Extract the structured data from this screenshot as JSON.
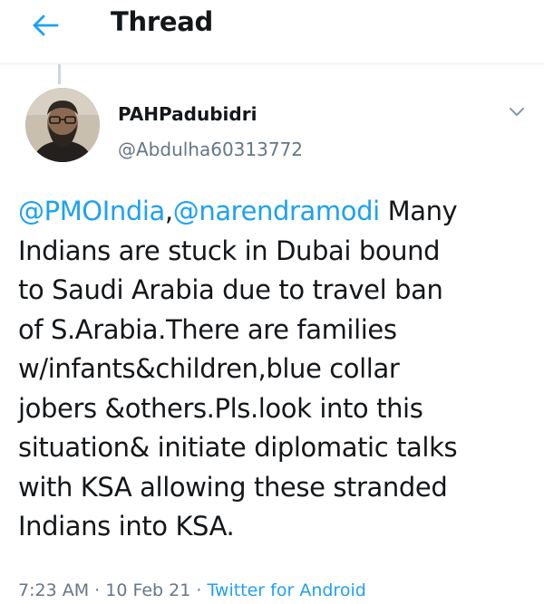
{
  "header": {
    "title": "Thread",
    "back_icon": "arrow-left-icon",
    "accent_color": "#1da1f2"
  },
  "tweet": {
    "author": {
      "display_name": "PAHPadubidri",
      "handle": "@Abdulha60313772",
      "avatar_icon": "user-avatar"
    },
    "menu_icon": "chevron-down-icon",
    "text": {
      "mention_1": "@PMOIndia",
      "separator": ",",
      "mention_2": "@narendramodi",
      "line_1_rest": " Many",
      "lines": [
        "Indians are stuck in Dubai bound",
        "to Saudi Arabia due to travel ban",
        "of S.Arabia.There are families",
        "w/infants&children,blue collar",
        "jobers &others.Pls.look into this",
        "situation& initiate diplomatic talks",
        "with KSA allowing these stranded",
        "Indians into KSA."
      ]
    },
    "meta": {
      "time": "7:23 AM",
      "dot_1": " · ",
      "date": "10 Feb 21",
      "dot_2": " · ",
      "source": "Twitter for Android"
    }
  },
  "colors": {
    "text_primary": "#14171a",
    "text_secondary": "#657786",
    "link": "#1da1f2",
    "divider": "#e6ecf0"
  }
}
